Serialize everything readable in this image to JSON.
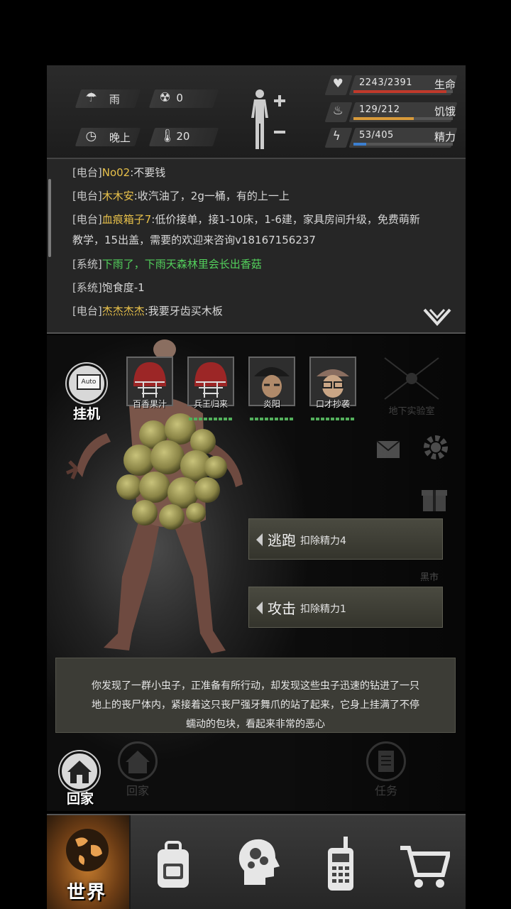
{
  "environment": {
    "weather": "雨",
    "radiation": "0",
    "time_of_day": "晚上",
    "temperature": "20"
  },
  "stats": [
    {
      "icon": "heart-icon",
      "value": "2243/2391",
      "label": "生命",
      "ratio": 0.938,
      "color": "#c0392b"
    },
    {
      "icon": "stomach-icon",
      "value": "129/212",
      "label": "饥饿",
      "ratio": 0.608,
      "color": "#d89a3a"
    },
    {
      "icon": "lightning-icon",
      "value": "53/405",
      "label": "精力",
      "ratio": 0.131,
      "color": "#3c7fd0"
    }
  ],
  "chat": [
    {
      "channel": "[电台]",
      "name": "No02",
      "text": ":不要钱"
    },
    {
      "channel": "[电台]",
      "name": "木木安",
      "text": ":收汽油了，2g一桶，有的上一上"
    },
    {
      "channel": "[电台]",
      "name": "血痕箱子7",
      "text": ":低价接单，接1-10床，1-6建，家具房间升级，免费萌新",
      "text2": "教学，15出盖，需要的欢迎来咨询v18167156237"
    },
    {
      "channel": "[系统]",
      "name": "",
      "text": "下雨了，下雨天森林里会长出香菇",
      "green": true
    },
    {
      "channel": "[系统]",
      "name": "",
      "text": "饱食度-1"
    },
    {
      "channel": "[电台]",
      "name": "杰杰杰杰",
      "text": ":我要牙齿买木板"
    }
  ],
  "auto_button": {
    "box": "Auto",
    "label": "挂机"
  },
  "party": [
    {
      "name": "百香果汁"
    },
    {
      "name": "兵王归来"
    },
    {
      "name": "炎阳"
    },
    {
      "name": "口才抄袭"
    }
  ],
  "lab": {
    "label": "地下实验室"
  },
  "black_market": {
    "label": "黑市"
  },
  "actions": [
    {
      "title": "逃跑",
      "cost": "扣除精力4"
    },
    {
      "title": "攻击",
      "cost": "扣除精力1"
    }
  ],
  "description": {
    "line1": "你发现了一群小虫子，正准备有所行动，却发现这些虫子迅速的钻进了一只",
    "line2": "地上的丧尸体内，紧接着这只丧尸强牙舞爪的站了起来，它身上挂满了不停",
    "line3": "蠕动的包块，看起来非常的恶心"
  },
  "scene_nav": {
    "home": "回家",
    "faded_home": "回家",
    "task": "任务"
  },
  "tabs": {
    "world": "世界"
  }
}
